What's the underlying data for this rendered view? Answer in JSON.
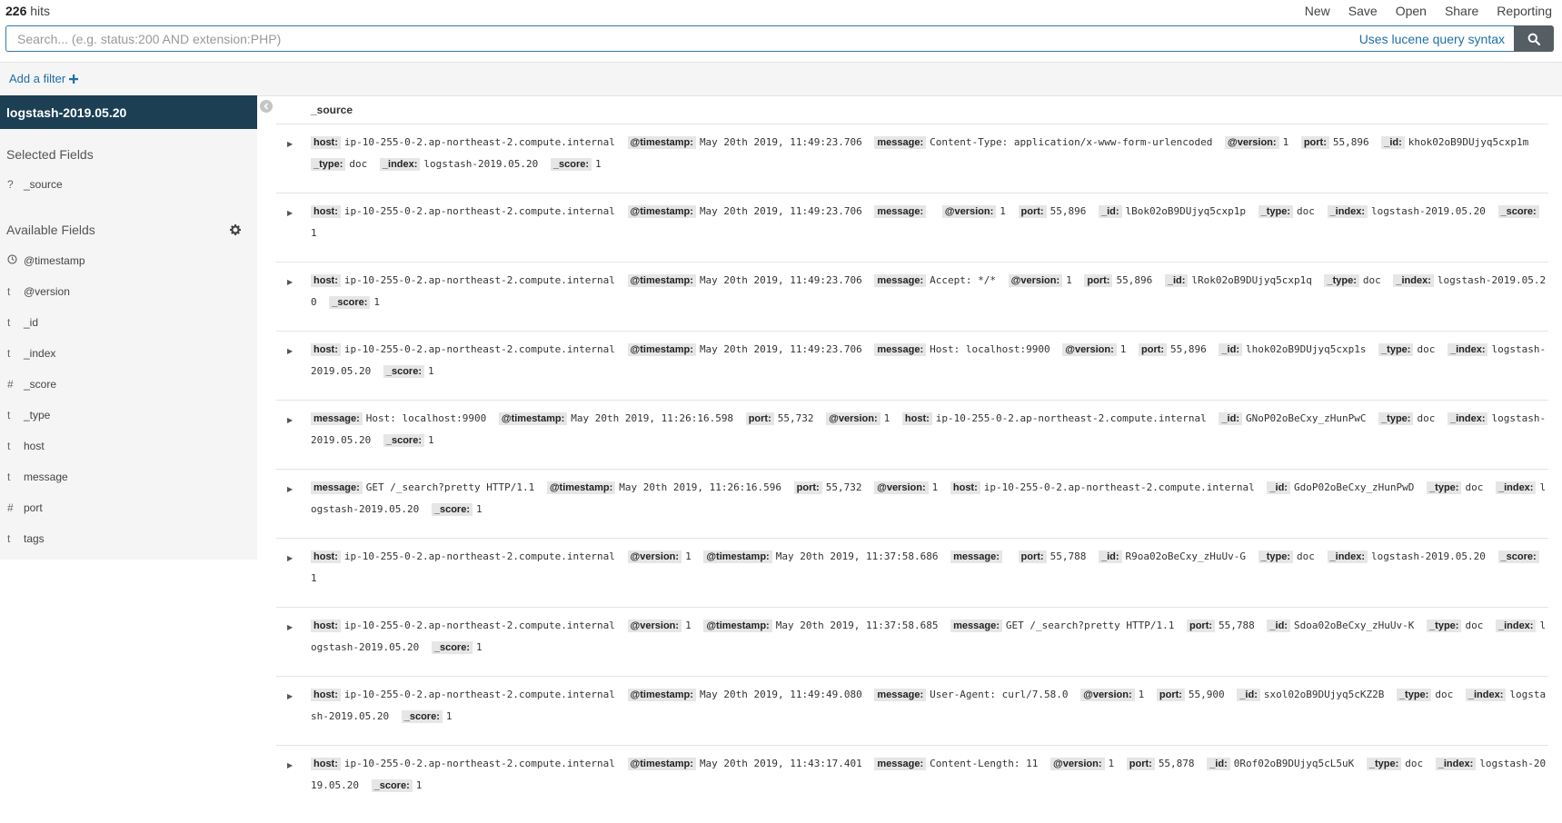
{
  "header": {
    "hits_count": "226",
    "hits_label": "hits",
    "menu": [
      "New",
      "Save",
      "Open",
      "Share",
      "Reporting"
    ]
  },
  "search": {
    "placeholder": "Search... (e.g. status:200 AND extension:PHP)",
    "syntax_link": "Uses lucene query syntax"
  },
  "filter": {
    "add_label": "Add a filter"
  },
  "sidebar": {
    "index_name": "logstash-2019.05.20",
    "selected_title": "Selected Fields",
    "selected_fields": [
      {
        "type": "?",
        "name": "_source"
      }
    ],
    "available_title": "Available Fields",
    "available_fields": [
      {
        "type": "clock",
        "name": "@timestamp"
      },
      {
        "type": "t",
        "name": "@version"
      },
      {
        "type": "t",
        "name": "_id"
      },
      {
        "type": "t",
        "name": "_index"
      },
      {
        "type": "#",
        "name": "_score"
      },
      {
        "type": "t",
        "name": "_type"
      },
      {
        "type": "t",
        "name": "host"
      },
      {
        "type": "t",
        "name": "message"
      },
      {
        "type": "#",
        "name": "port"
      },
      {
        "type": "t",
        "name": "tags"
      }
    ]
  },
  "results": {
    "column": "_source",
    "rows": [
      [
        [
          "host:",
          "ip-10-255-0-2.ap-northeast-2.compute.internal"
        ],
        [
          "@timestamp:",
          "May 20th 2019, 11:49:23.706"
        ],
        [
          "message:",
          "Content-Type: application/x-www-form-urlencoded"
        ],
        [
          "@version:",
          "1"
        ],
        [
          "port:",
          "55,896"
        ],
        [
          "_id:",
          "khok02oB9DUjyq5cxp1m"
        ],
        [
          "_type:",
          "doc"
        ],
        [
          "_index:",
          "logstash-2019.05.20"
        ],
        [
          "_score:",
          "1"
        ]
      ],
      [
        [
          "host:",
          "ip-10-255-0-2.ap-northeast-2.compute.internal"
        ],
        [
          "@timestamp:",
          "May 20th 2019, 11:49:23.706"
        ],
        [
          "message:",
          ""
        ],
        [
          "@version:",
          "1"
        ],
        [
          "port:",
          "55,896"
        ],
        [
          "_id:",
          "lBok02oB9DUjyq5cxp1p"
        ],
        [
          "_type:",
          "doc"
        ],
        [
          "_index:",
          "logstash-2019.05.20"
        ],
        [
          "_score:",
          "1"
        ]
      ],
      [
        [
          "host:",
          "ip-10-255-0-2.ap-northeast-2.compute.internal"
        ],
        [
          "@timestamp:",
          "May 20th 2019, 11:49:23.706"
        ],
        [
          "message:",
          "Accept: */*"
        ],
        [
          "@version:",
          "1"
        ],
        [
          "port:",
          "55,896"
        ],
        [
          "_id:",
          "lRok02oB9DUjyq5cxp1q"
        ],
        [
          "_type:",
          "doc"
        ],
        [
          "_index:",
          "logstash-2019.05.20"
        ],
        [
          "_score:",
          "1"
        ]
      ],
      [
        [
          "host:",
          "ip-10-255-0-2.ap-northeast-2.compute.internal"
        ],
        [
          "@timestamp:",
          "May 20th 2019, 11:49:23.706"
        ],
        [
          "message:",
          "Host: localhost:9900"
        ],
        [
          "@version:",
          "1"
        ],
        [
          "port:",
          "55,896"
        ],
        [
          "_id:",
          "lhok02oB9DUjyq5cxp1s"
        ],
        [
          "_type:",
          "doc"
        ],
        [
          "_index:",
          "logstash-2019.05.20"
        ],
        [
          "_score:",
          "1"
        ]
      ],
      [
        [
          "message:",
          "Host: localhost:9900"
        ],
        [
          "@timestamp:",
          "May 20th 2019, 11:26:16.598"
        ],
        [
          "port:",
          "55,732"
        ],
        [
          "@version:",
          "1"
        ],
        [
          "host:",
          "ip-10-255-0-2.ap-northeast-2.compute.internal"
        ],
        [
          "_id:",
          "GNoP02oBeCxy_zHunPwC"
        ],
        [
          "_type:",
          "doc"
        ],
        [
          "_index:",
          "logstash-2019.05.20"
        ],
        [
          "_score:",
          "1"
        ]
      ],
      [
        [
          "message:",
          "GET /_search?pretty HTTP/1.1"
        ],
        [
          "@timestamp:",
          "May 20th 2019, 11:26:16.596"
        ],
        [
          "port:",
          "55,732"
        ],
        [
          "@version:",
          "1"
        ],
        [
          "host:",
          "ip-10-255-0-2.ap-northeast-2.compute.internal"
        ],
        [
          "_id:",
          "GdoP02oBeCxy_zHunPwD"
        ],
        [
          "_type:",
          "doc"
        ],
        [
          "_index:",
          "logstash-2019.05.20"
        ],
        [
          "_score:",
          "1"
        ]
      ],
      [
        [
          "host:",
          "ip-10-255-0-2.ap-northeast-2.compute.internal"
        ],
        [
          "@version:",
          "1"
        ],
        [
          "@timestamp:",
          "May 20th 2019, 11:37:58.686"
        ],
        [
          "message:",
          ""
        ],
        [
          "port:",
          "55,788"
        ],
        [
          "_id:",
          "R9oa02oBeCxy_zHuUv-G"
        ],
        [
          "_type:",
          "doc"
        ],
        [
          "_index:",
          "logstash-2019.05.20"
        ],
        [
          "_score:",
          "1"
        ]
      ],
      [
        [
          "host:",
          "ip-10-255-0-2.ap-northeast-2.compute.internal"
        ],
        [
          "@version:",
          "1"
        ],
        [
          "@timestamp:",
          "May 20th 2019, 11:37:58.685"
        ],
        [
          "message:",
          "GET /_search?pretty HTTP/1.1"
        ],
        [
          "port:",
          "55,788"
        ],
        [
          "_id:",
          "Sdoa02oBeCxy_zHuUv-K"
        ],
        [
          "_type:",
          "doc"
        ],
        [
          "_index:",
          "logstash-2019.05.20"
        ],
        [
          "_score:",
          "1"
        ]
      ],
      [
        [
          "host:",
          "ip-10-255-0-2.ap-northeast-2.compute.internal"
        ],
        [
          "@timestamp:",
          "May 20th 2019, 11:49:49.080"
        ],
        [
          "message:",
          "User-Agent: curl/7.58.0"
        ],
        [
          "@version:",
          "1"
        ],
        [
          "port:",
          "55,900"
        ],
        [
          "_id:",
          "sxol02oB9DUjyq5cKZ2B"
        ],
        [
          "_type:",
          "doc"
        ],
        [
          "_index:",
          "logstash-2019.05.20"
        ],
        [
          "_score:",
          "1"
        ]
      ],
      [
        [
          "host:",
          "ip-10-255-0-2.ap-northeast-2.compute.internal"
        ],
        [
          "@timestamp:",
          "May 20th 2019, 11:43:17.401"
        ],
        [
          "message:",
          "Content-Length: 11"
        ],
        [
          "@version:",
          "1"
        ],
        [
          "port:",
          "55,878"
        ],
        [
          "_id:",
          "0Rof02oB9DUjyq5cL5uK"
        ],
        [
          "_type:",
          "doc"
        ],
        [
          "_index:",
          "logstash-2019.05.20"
        ],
        [
          "_score:",
          "1"
        ]
      ]
    ]
  }
}
